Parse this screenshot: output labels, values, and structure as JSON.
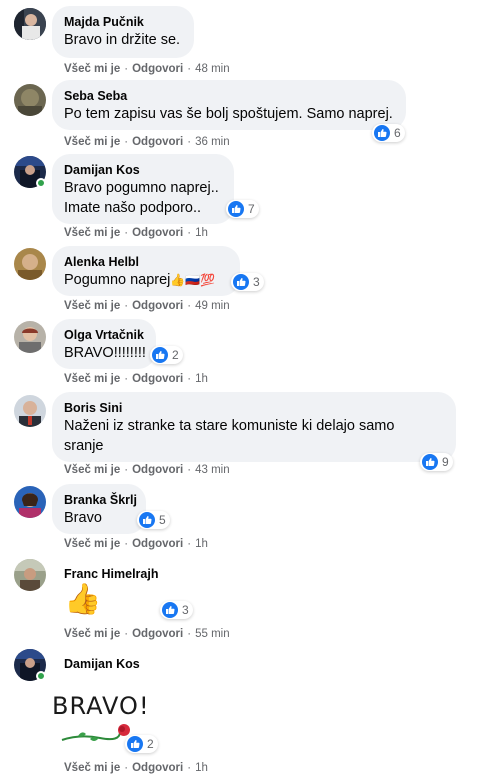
{
  "actions": {
    "like": "Všeč mi je",
    "reply": "Odgovori"
  },
  "comments": [
    {
      "author": "Majda Pučnik",
      "lines": [
        "Bravo in držite se."
      ],
      "time": "48 min",
      "reactions": ""
    },
    {
      "author": "Seba Seba",
      "lines": [
        "Po tem zapisu vas še bolj spoštujem. Samo naprej."
      ],
      "time": "36 min",
      "reactions": "6"
    },
    {
      "author": "Damijan Kos",
      "lines": [
        "Bravo pogumno naprej..",
        "Imate našo podporo.."
      ],
      "time": "1h",
      "reactions": "7"
    },
    {
      "author": "Alenka Helbl",
      "lines": [
        "Pogumno naprej"
      ],
      "emoji": "👍🇷🇺💯",
      "time": "49 min",
      "reactions": "3"
    },
    {
      "author": "Olga Vrtačnik",
      "lines": [
        "BRAVO!!!!!!!!"
      ],
      "time": "1h",
      "reactions": "2"
    },
    {
      "author": "Boris Sini",
      "lines": [
        "Naženi iz stranke ta stare komuniste ki delajo samo",
        "sranje"
      ],
      "time": "43 min",
      "reactions": "9"
    },
    {
      "author": "Branka Škrlj",
      "lines": [
        "Bravo"
      ],
      "time": "1h",
      "reactions": "5"
    },
    {
      "author": "Franc Himelrajh",
      "sticker": "👍",
      "time": "55 min",
      "reactions": "3"
    },
    {
      "author": "Damijan Kos",
      "sticker_text": "BRAVO!",
      "time": "1h",
      "reactions": "2"
    }
  ],
  "colors": {
    "bubble": "#f0f2f5",
    "like_blue": "#1877f2",
    "meta_gray": "#65676b",
    "online": "#31a24c"
  }
}
